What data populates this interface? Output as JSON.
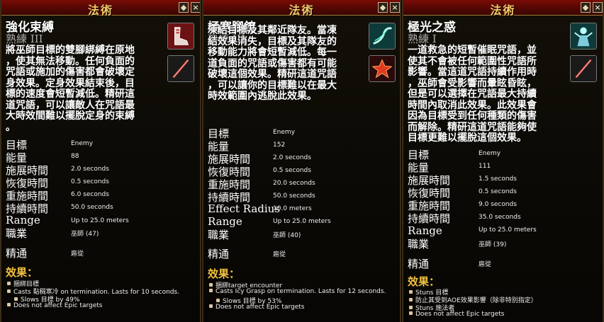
{
  "window_title": "法術",
  "buttons": {
    "menu": "◆",
    "close": "×"
  },
  "panels": [
    {
      "name": "強化束縛",
      "rank": "熟練 III",
      "icons": [
        "boots-icon",
        "staff-icon"
      ],
      "desc": [
        "將巫師目標的雙腳綁縛在原地",
        "，使其無法移動。任何負面的",
        "咒語或施加的傷害都會破壞定",
        "身效果。定身效果結束後，目",
        "標的速度會短暫減低。精研這",
        "道咒語，可以讓敵人在咒語最",
        "大時效間難以擺脫定身的束縛",
        "。"
      ],
      "stats": [
        {
          "label": "目標",
          "value": "Enemy"
        },
        {
          "label": "能量",
          "value": "88"
        },
        {
          "label": "施展時間",
          "value": "2.0 seconds"
        },
        {
          "label": "恢復時間",
          "value": "0.5 seconds"
        },
        {
          "label": "重施時間",
          "value": "6.0 seconds"
        },
        {
          "label": "持續時間",
          "value": "50.0 seconds"
        },
        {
          "label": "Range",
          "value": "Up to 25.0 meters"
        },
        {
          "label": "職業",
          "value": "巫師 (47)"
        },
        {
          "label": "精通",
          "value": "扈從"
        }
      ],
      "effects_title": "效果：",
      "effects": [
        {
          "text": "捆綁目標",
          "sub": false
        },
        {
          "text": "Casts 黏稠寒冷 on termination.  Lasts for 10 seconds.",
          "sub": false
        },
        {
          "text": "Slows 目標 by 49%",
          "sub": true
        },
        {
          "text": "Does not affect Epic targets",
          "sub": false
        }
      ]
    },
    {
      "name": "極寒腳鐐",
      "rank": "熟練 III",
      "icons": [
        "frost-swirl-icon",
        "red-star-icon"
      ],
      "desc": [
        "凍結目標及其鄰近隊友。當凍",
        "結效果消失，目標及其隊友的",
        "移動能力將會短暫減低。每一",
        "道負面的咒語或傷害都有可能",
        "破壞這個效果。精研這道咒語",
        "，可以讓你的目標難以在最大",
        "時效範圍內逃脫此效果。"
      ],
      "stats": [
        {
          "label": "目標",
          "value": "Enemy"
        },
        {
          "label": "能量",
          "value": "152"
        },
        {
          "label": "施展時間",
          "value": "2.0 seconds"
        },
        {
          "label": "恢復時間",
          "value": "0.5 seconds"
        },
        {
          "label": "重施時間",
          "value": "20.0 seconds"
        },
        {
          "label": "持續時間",
          "value": "50.0 seconds"
        },
        {
          "label": "Effect Radius",
          "value": "10.0 meters"
        },
        {
          "label": "Range",
          "value": "Up to 25.0 meters"
        },
        {
          "label": "職業",
          "value": "巫師 (40)"
        },
        {
          "label": "精通",
          "value": "扈從"
        }
      ],
      "effects_title": "效果：",
      "effects": [
        {
          "text": "捆綁target encounter",
          "sub": false
        },
        {
          "text": "Casts Icy Grasp on termination.  Lasts for 12 seconds.",
          "sub": false
        },
        {
          "text": "Slows 目標 by 53%",
          "sub": true
        },
        {
          "text": "Does not affect Epic targets",
          "sub": false
        }
      ]
    },
    {
      "name": "極光之惑",
      "rank": "熟練 I",
      "icons": [
        "ghost-figure-icon",
        "staff-icon"
      ],
      "desc": [
        "一道救急的短暫催眠咒語，並",
        "使其不會被任何範圍性咒語所",
        "影響。當這道咒語持續作用時",
        "，巫師會受影響而暈眩昏眩，",
        "但是可以選擇在咒語最大持續",
        "時間內取消此效果。此效果會",
        "因為目標受到任何種類的傷害",
        "而解除。精研這道咒語能夠使",
        "目標更難以擺脫這個效果。"
      ],
      "stats": [
        {
          "label": "目標",
          "value": "Enemy"
        },
        {
          "label": "能量",
          "value": "111"
        },
        {
          "label": "施展時間",
          "value": "1.5 seconds"
        },
        {
          "label": "恢復時間",
          "value": "0.5 seconds"
        },
        {
          "label": "重施時間",
          "value": "9.0 seconds"
        },
        {
          "label": "持續時間",
          "value": "35.0 seconds"
        },
        {
          "label": "Range",
          "value": "Up to 25.0 meters"
        },
        {
          "label": "職業",
          "value": "巫師 (39)"
        },
        {
          "label": "精通",
          "value": "扈從"
        }
      ],
      "effects_title": "效果：",
      "effects": [
        {
          "text": "Stuns 目標",
          "sub": false
        },
        {
          "text": "防止其受到AOE效果影響（除非特別指定）",
          "sub": false
        },
        {
          "text": "Stuns 施法者",
          "sub": false
        },
        {
          "text": "Does not affect Epic targets",
          "sub": false
        }
      ]
    }
  ]
}
